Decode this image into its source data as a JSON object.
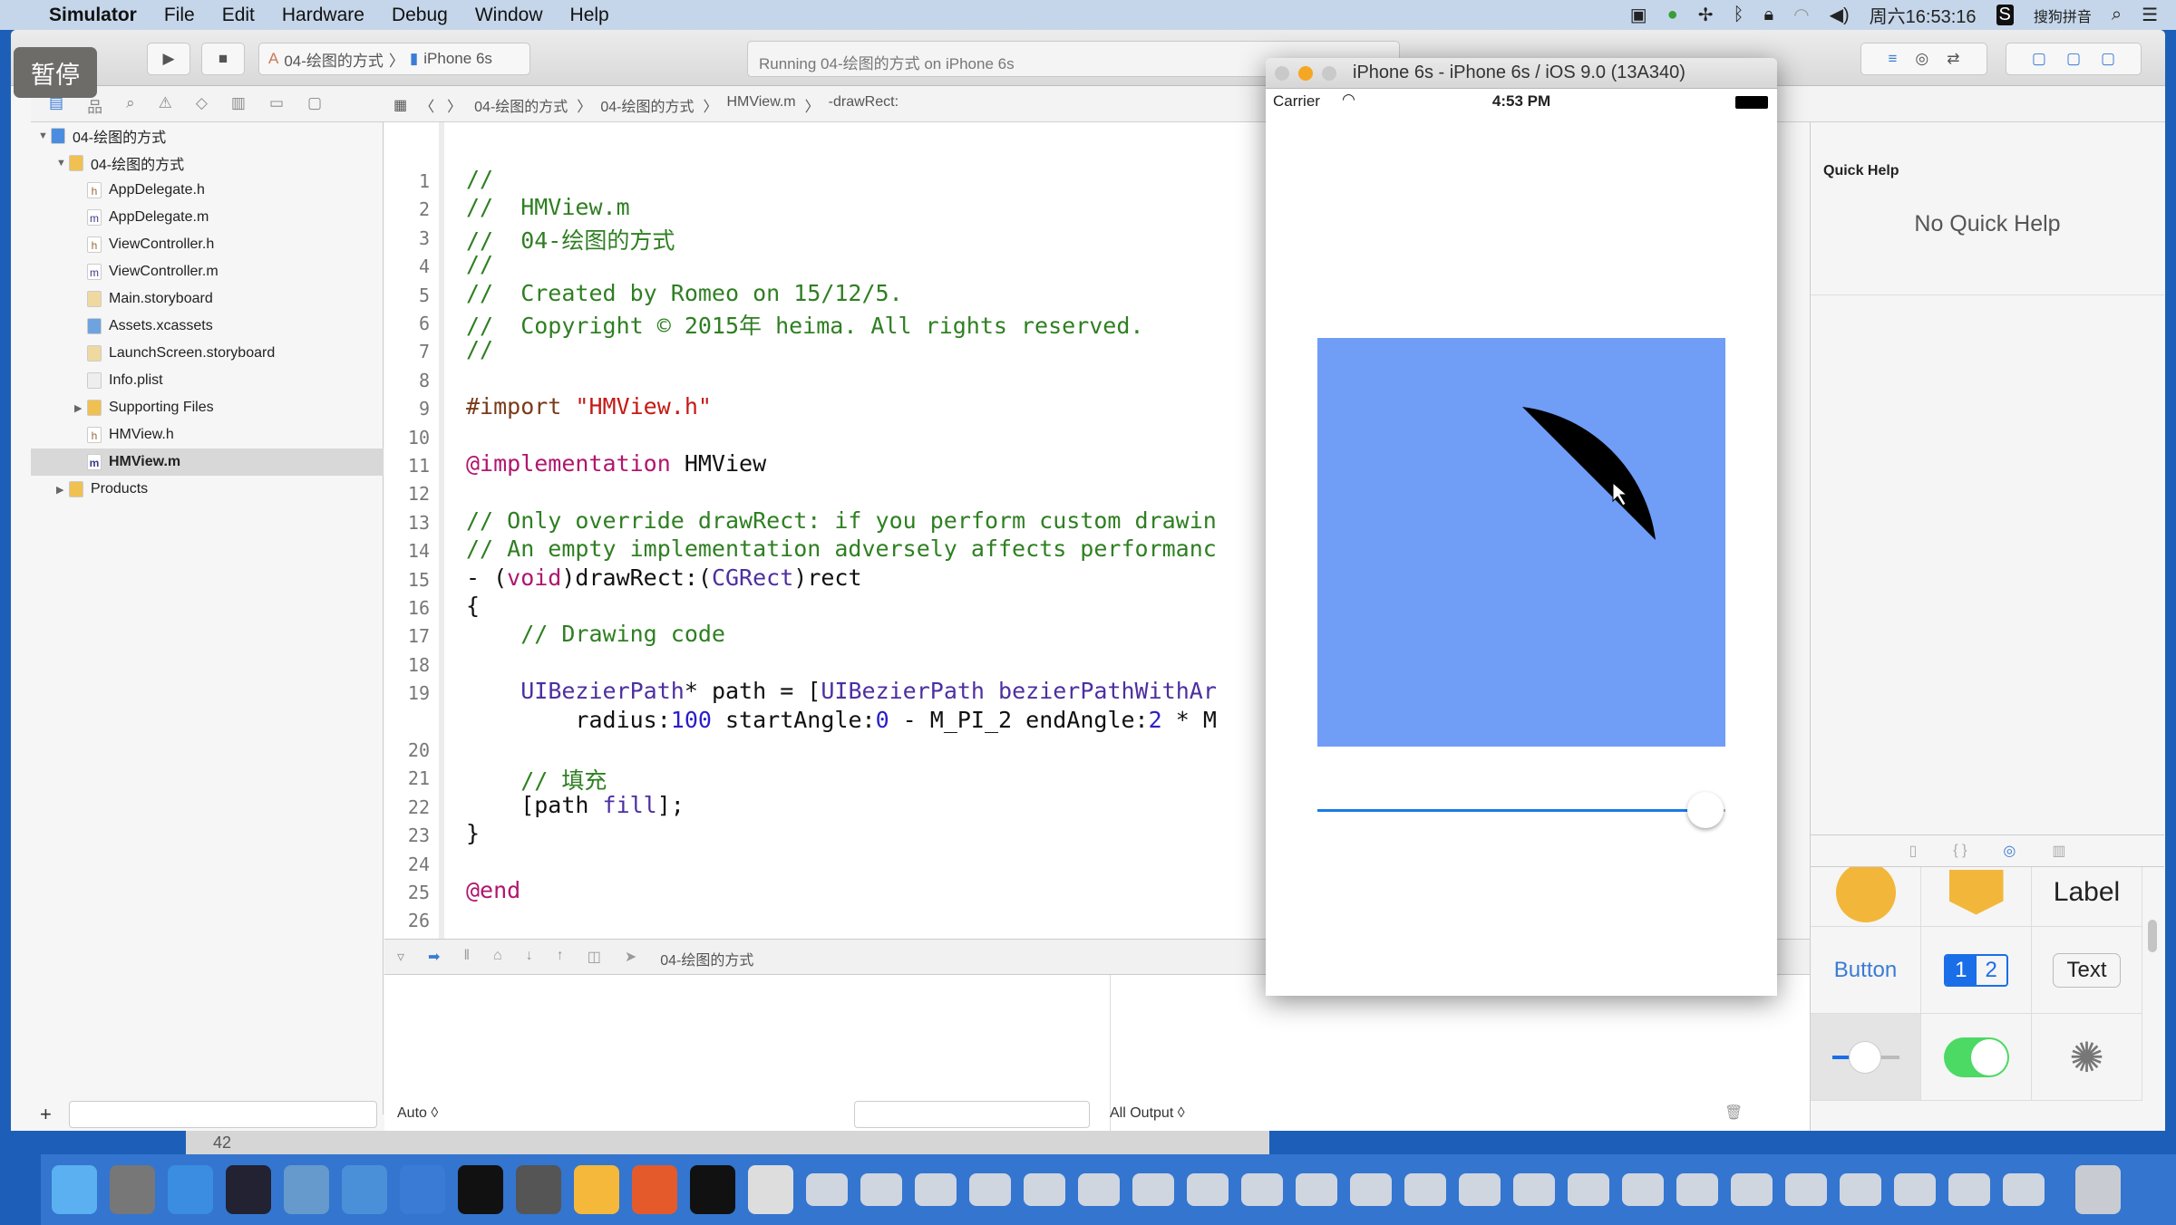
{
  "menubar": {
    "apple": "apple-icon",
    "app": "Simulator",
    "items": [
      "File",
      "Edit",
      "Hardware",
      "Debug",
      "Window",
      "Help"
    ],
    "clock": "周六16:53:16",
    "ime": "搜狗拼音"
  },
  "overlay": {
    "pause": "暂停"
  },
  "toolbar": {
    "scheme": "04-绘图的方式",
    "device": "iPhone 6s",
    "status": "Running 04-绘图的方式 on iPhone 6s"
  },
  "jumpbar": [
    "04-绘图的方式",
    "04-绘图的方式",
    "HMView.m",
    "-drawRect:"
  ],
  "navigator": {
    "items": [
      {
        "label": "04-绘图的方式",
        "icon": "project",
        "level": 0,
        "open": true
      },
      {
        "label": "04-绘图的方式",
        "icon": "folder",
        "level": 1,
        "open": true
      },
      {
        "label": "AppDelegate.h",
        "icon": "h",
        "level": 2
      },
      {
        "label": "AppDelegate.m",
        "icon": "m",
        "level": 2
      },
      {
        "label": "ViewController.h",
        "icon": "h",
        "level": 2
      },
      {
        "label": "ViewController.m",
        "icon": "m",
        "level": 2
      },
      {
        "label": "Main.storyboard",
        "icon": "sb",
        "level": 2
      },
      {
        "label": "Assets.xcassets",
        "icon": "assets",
        "level": 2
      },
      {
        "label": "LaunchScreen.storyboard",
        "icon": "sb",
        "level": 2
      },
      {
        "label": "Info.plist",
        "icon": "plist",
        "level": 2
      },
      {
        "label": "Supporting Files",
        "icon": "folder",
        "level": 2,
        "closed": true
      },
      {
        "label": "HMView.h",
        "icon": "h",
        "level": 2
      },
      {
        "label": "HMView.m",
        "icon": "m",
        "level": 2,
        "selected": true
      },
      {
        "label": "Products",
        "icon": "folder",
        "level": 1,
        "closed": true
      }
    ]
  },
  "code": [
    [
      [
        "//",
        "comment"
      ]
    ],
    [
      [
        "//  HMView.m",
        "comment"
      ]
    ],
    [
      [
        "//  04-绘图的方式",
        "comment"
      ]
    ],
    [
      [
        "//",
        "comment"
      ]
    ],
    [
      [
        "//  Created by Romeo on 15/12/5.",
        "comment"
      ]
    ],
    [
      [
        "//  Copyright © 2015年 heima. All rights reserved.",
        "comment"
      ]
    ],
    [
      [
        "//",
        "comment"
      ]
    ],
    [],
    [
      [
        "#import ",
        "pre"
      ],
      [
        "\"HMView.h\"",
        "str"
      ]
    ],
    [],
    [
      [
        "@implementation",
        "kw"
      ],
      [
        " HMView",
        "plain"
      ]
    ],
    [],
    [
      [
        "// Only override drawRect: if you perform custom drawin",
        "comment"
      ]
    ],
    [
      [
        "// An empty implementation adversely affects performanc",
        "comment"
      ]
    ],
    [
      [
        "- (",
        "plain"
      ],
      [
        "void",
        "kw"
      ],
      [
        ")drawRect:(",
        "plain"
      ],
      [
        "CGRect",
        "type"
      ],
      [
        ")rect",
        "plain"
      ]
    ],
    [
      [
        "{",
        "plain"
      ]
    ],
    [
      [
        "    // Drawing code",
        "comment"
      ]
    ],
    [],
    [
      [
        "    ",
        "plain"
      ],
      [
        "UIBezierPath",
        "type"
      ],
      [
        "* path = [",
        "plain"
      ],
      [
        "UIBezierPath",
        "type"
      ],
      [
        " ",
        "plain"
      ],
      [
        "bezierPathWithAr",
        "type"
      ]
    ],
    [
      [
        "        radius:",
        "plain"
      ],
      [
        "100",
        "num"
      ],
      [
        " startAngle:",
        "plain"
      ],
      [
        "0",
        "num"
      ],
      [
        " - M_PI_2 endAngle:",
        "plain"
      ],
      [
        "2",
        "num"
      ],
      [
        " * M",
        "plain"
      ]
    ],
    [],
    [
      [
        "    // 填充",
        "comment"
      ]
    ],
    [
      [
        "    [path ",
        "plain"
      ],
      [
        "fill",
        "type"
      ],
      [
        "];",
        "plain"
      ]
    ],
    [
      [
        "}",
        "plain"
      ]
    ],
    [],
    [
      [
        "@end",
        "kw"
      ]
    ],
    []
  ],
  "line_numbers": [
    "1",
    "2",
    "3",
    "4",
    "5",
    "6",
    "7",
    "8",
    "9",
    "10",
    "11",
    "12",
    "13",
    "14",
    "15",
    "16",
    "17",
    "18",
    "19",
    "",
    "20",
    "21",
    "22",
    "23",
    "24",
    "25",
    "26"
  ],
  "debug": {
    "target": "04-绘图的方式",
    "auto": "Auto ◊",
    "output": "All Output ◊"
  },
  "inspector": {
    "title": "Quick Help",
    "empty": "No Quick Help",
    "library": {
      "label": "Label",
      "button": "Button",
      "seg1": "1",
      "seg2": "2",
      "text": "Text"
    }
  },
  "simulator": {
    "title": "iPhone 6s - iPhone 6s / iOS 9.0 (13A340)",
    "carrier": "Carrier",
    "time": "4:53 PM",
    "view_color": "#709df6",
    "slider_value": 0.95
  },
  "strip": {
    "value": "42"
  },
  "colors": {
    "accent": "#1a6ee8",
    "switch": "#4cd964"
  }
}
